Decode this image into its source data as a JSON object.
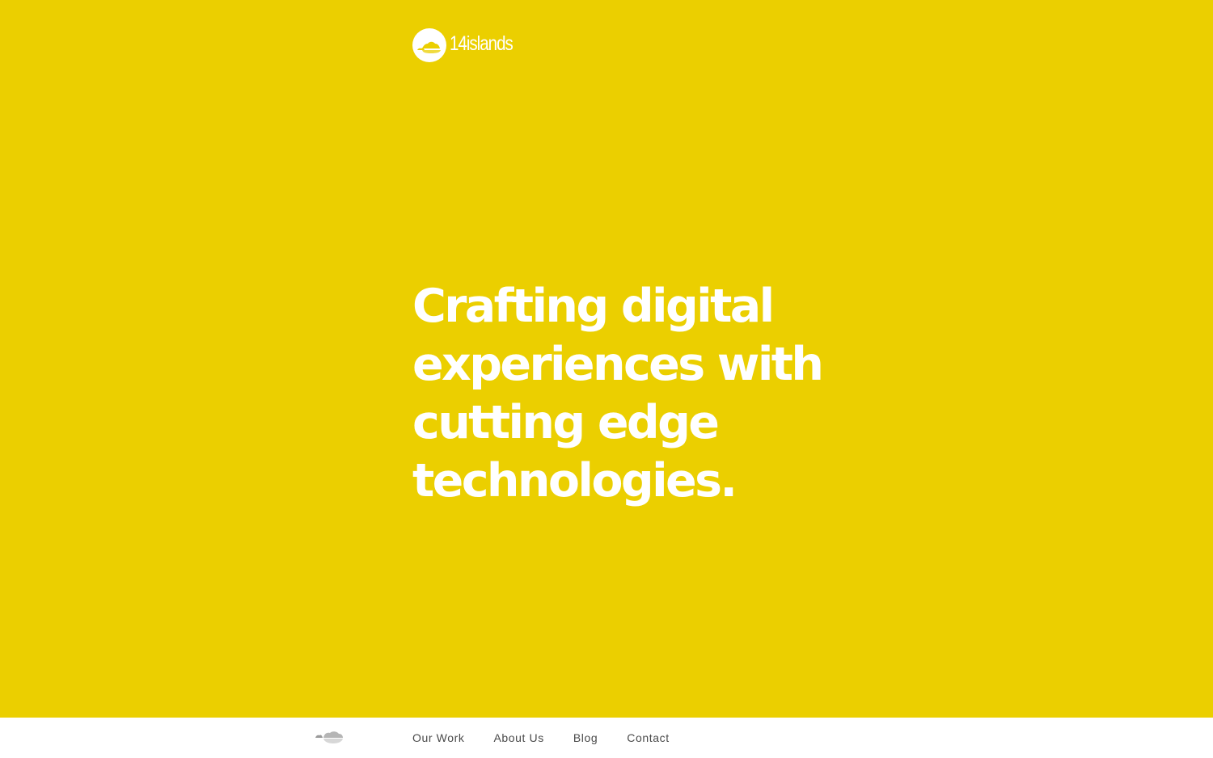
{
  "colors": {
    "accent": "#ebcf00",
    "footer_bg": "#ffffff",
    "nav_text": "#4a4a4a"
  },
  "header": {
    "logo_icon": "island-logo-icon",
    "logo_text": "14islands"
  },
  "hero": {
    "headline": "Crafting digital experiences with cutting edge technologies."
  },
  "footer": {
    "logo_icon": "island-cloud-icon",
    "nav": [
      {
        "label": "Our Work"
      },
      {
        "label": "About Us"
      },
      {
        "label": "Blog"
      },
      {
        "label": "Contact"
      }
    ]
  }
}
